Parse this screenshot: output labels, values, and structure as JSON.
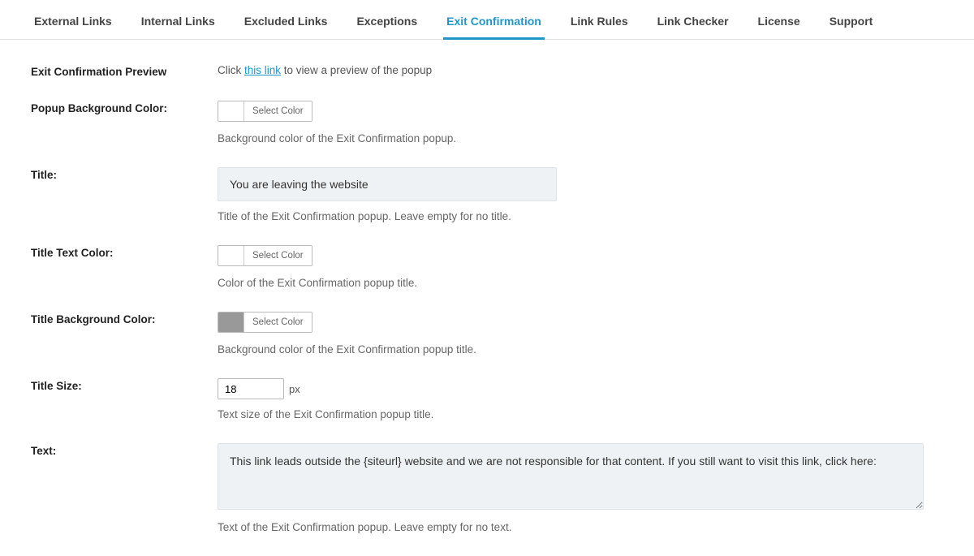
{
  "tabs": [
    {
      "label": "External Links"
    },
    {
      "label": "Internal Links"
    },
    {
      "label": "Excluded Links"
    },
    {
      "label": "Exceptions"
    },
    {
      "label": "Exit Confirmation"
    },
    {
      "label": "Link Rules"
    },
    {
      "label": "Link Checker"
    },
    {
      "label": "License"
    },
    {
      "label": "Support"
    }
  ],
  "activeTab": 4,
  "preview": {
    "label": "Exit Confirmation Preview",
    "pre": "Click ",
    "link": "this link",
    "post": " to view a preview of the popup"
  },
  "bgColor": {
    "label": "Popup Background Color:",
    "button": "Select Color",
    "help": "Background color of the Exit Confirmation popup."
  },
  "title": {
    "label": "Title:",
    "value": "You are leaving the website",
    "help": "Title of the Exit Confirmation popup. Leave empty for no title."
  },
  "titleColor": {
    "label": "Title Text Color:",
    "button": "Select Color",
    "help": "Color of the Exit Confirmation popup title."
  },
  "titleBg": {
    "label": "Title Background Color:",
    "button": "Select Color",
    "help": "Background color of the Exit Confirmation popup title."
  },
  "titleSize": {
    "label": "Title Size:",
    "value": "18",
    "unit": "px",
    "help": "Text size of the Exit Confirmation popup title."
  },
  "text": {
    "label": "Text:",
    "value": "This link leads outside the {siteurl} website and we are not responsible for that content. If you still want to visit this link, click here:",
    "help": "Text of the Exit Confirmation popup. Leave empty for no text."
  }
}
